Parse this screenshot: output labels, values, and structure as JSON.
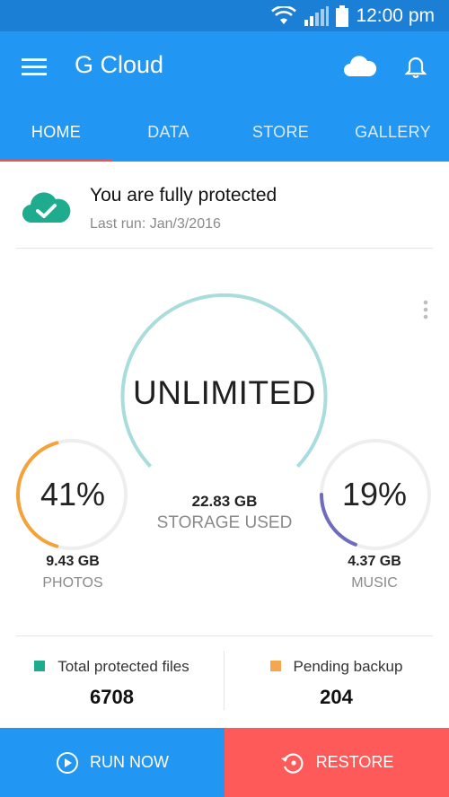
{
  "status_bar": {
    "time": "12:00 pm",
    "icons": [
      "wifi-icon",
      "signal-icon",
      "battery-icon"
    ]
  },
  "app_bar": {
    "title": "G Cloud"
  },
  "tabs": [
    {
      "label": "HOME",
      "active": true
    },
    {
      "label": "DATA",
      "active": false
    },
    {
      "label": "STORE",
      "active": false
    },
    {
      "label": "GALLERY",
      "active": false
    }
  ],
  "protection": {
    "title": "You are fully protected",
    "last_run": "Last run: Jan/3/2016"
  },
  "storage": {
    "plan": "UNLIMITED",
    "used_value": "22.83 GB",
    "used_label": "STORAGE USED",
    "photos": {
      "percent_text": "41%",
      "fraction": 0.41,
      "size": "9.43 GB",
      "label": "PHOTOS",
      "color": "#f5a23a"
    },
    "music": {
      "percent_text": "19%",
      "fraction": 0.19,
      "size": "4.37 GB",
      "label": "MUSIC",
      "color": "#6f6bbd"
    }
  },
  "stats": {
    "protected": {
      "label": "Total protected files",
      "value": "6708",
      "color": "#1eab8e"
    },
    "pending": {
      "label": "Pending backup",
      "value": "204",
      "color": "#f5a74f"
    }
  },
  "actions": {
    "run_now": "RUN NOW",
    "restore": "RESTORE"
  },
  "colors": {
    "primary": "#2196f3",
    "status_bar": "#1c7fd6",
    "accent_red": "#ff5a5a",
    "tab_indicator": "#f0524b",
    "ring_main": "#a9dcdc"
  }
}
